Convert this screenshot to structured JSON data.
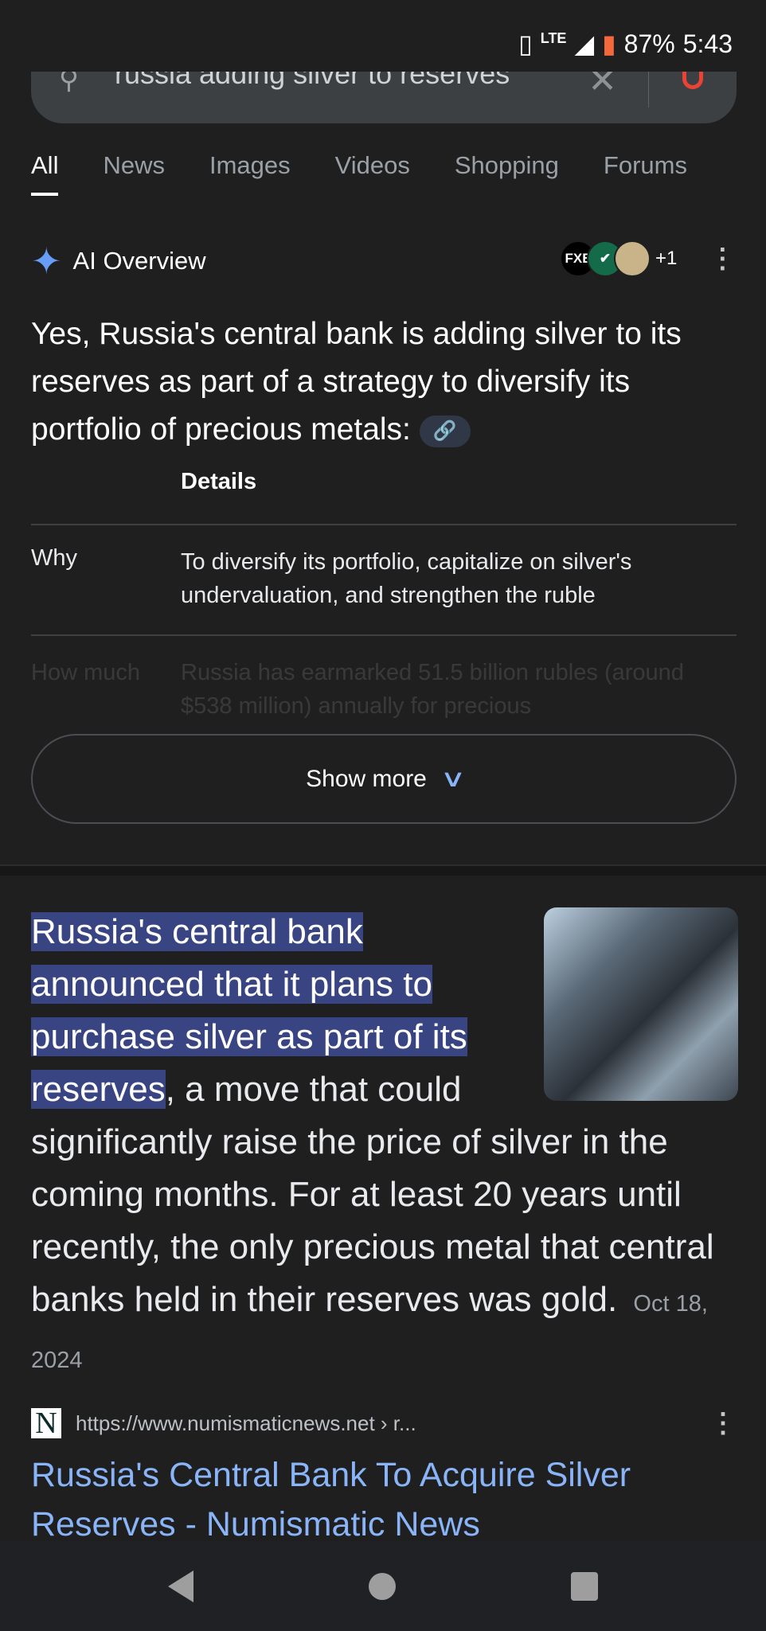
{
  "status_bar": {
    "network": "LTE",
    "battery": "87%",
    "time": "5:43"
  },
  "search": {
    "query": "russia adding silver to reserves"
  },
  "tabs": [
    {
      "label": "All",
      "active": true
    },
    {
      "label": "News"
    },
    {
      "label": "Images"
    },
    {
      "label": "Videos"
    },
    {
      "label": "Shopping"
    },
    {
      "label": "Forums"
    }
  ],
  "ai_overview": {
    "title": "AI Overview",
    "sources": {
      "first": "FXE",
      "more": "+1"
    },
    "intro": "Yes, Russia's central bank is adding silver to its reserves as part of a strategy to diversify its portfolio of precious metals:",
    "table": {
      "header": "Details",
      "rows": [
        {
          "key": "Why",
          "value": "To diversify its portfolio, capitalize on silver's undervaluation, and strengthen the ruble"
        },
        {
          "key": "How much",
          "value": "Russia has earmarked 51.5 billion rubles (around $538 million) annually for precious"
        }
      ]
    },
    "show_more": "Show more"
  },
  "featured_snippet": {
    "highlight": "Russia's central bank announced that it plans to purchase silver as part of its reserves",
    "rest": ", a move that could significantly raise the price of silver in the coming months. For at least 20 years until recently, the only precious metal that central banks held in their reserves was gold.",
    "date": "Oct 18, 2024",
    "source_url": "https://www.numismaticnews.net › r...",
    "source_logo": "N",
    "title": "Russia's Central Bank To Acquire Silver Reserves - Numismatic News"
  },
  "colors": {
    "background": "#1f1f1f",
    "link": "#8ab4f8",
    "highlight": "#394482"
  }
}
